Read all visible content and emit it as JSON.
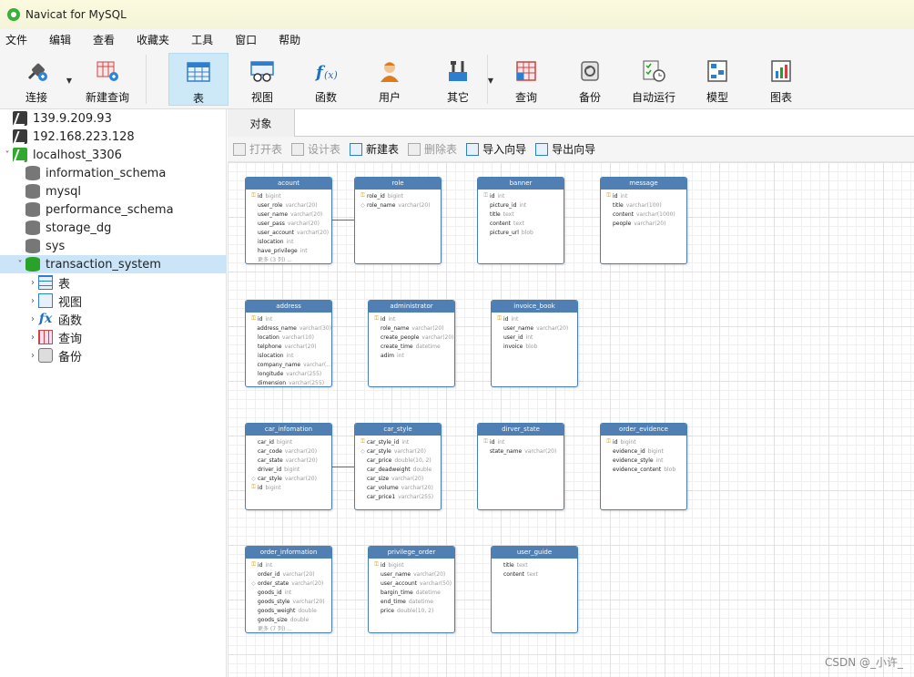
{
  "app": {
    "title": "Navicat for MySQL"
  },
  "menu": [
    "文件",
    "编辑",
    "查看",
    "收藏夹",
    "工具",
    "窗口",
    "帮助"
  ],
  "toolbar": [
    {
      "id": "connect",
      "label": "连接",
      "icon": "plug-icon"
    },
    {
      "id": "new-query",
      "label": "新建查询",
      "icon": "new-query-icon"
    },
    {
      "id": "table",
      "label": "表",
      "icon": "table-icon",
      "active": true
    },
    {
      "id": "view",
      "label": "视图",
      "icon": "view-icon"
    },
    {
      "id": "function",
      "label": "函数",
      "icon": "function-icon"
    },
    {
      "id": "user",
      "label": "用户",
      "icon": "user-icon"
    },
    {
      "id": "other",
      "label": "其它",
      "icon": "tools-icon"
    },
    {
      "id": "query",
      "label": "查询",
      "icon": "query-icon"
    },
    {
      "id": "backup",
      "label": "备份",
      "icon": "backup-icon"
    },
    {
      "id": "auto-run",
      "label": "自动运行",
      "icon": "schedule-icon"
    },
    {
      "id": "model",
      "label": "模型",
      "icon": "model-icon"
    },
    {
      "id": "chart",
      "label": "图表",
      "icon": "chart-icon"
    }
  ],
  "tree": [
    {
      "label": "139.9.209.93",
      "icon": "server-icon",
      "level": 0
    },
    {
      "label": "192.168.223.128",
      "icon": "server-icon",
      "level": 0
    },
    {
      "label": "localhost_3306",
      "icon": "server-connected-icon",
      "level": 0,
      "expanded": true
    },
    {
      "label": "information_schema",
      "icon": "database-icon",
      "level": 1
    },
    {
      "label": "mysql",
      "icon": "database-icon",
      "level": 1
    },
    {
      "label": "performance_schema",
      "icon": "database-icon",
      "level": 1
    },
    {
      "label": "storage_dg",
      "icon": "database-icon",
      "level": 1
    },
    {
      "label": "sys",
      "icon": "database-icon",
      "level": 1
    },
    {
      "label": "transaction_system",
      "icon": "database-open-icon",
      "level": 1,
      "expanded": true,
      "selected": true
    },
    {
      "label": "表",
      "icon": "table-icon",
      "level": 2
    },
    {
      "label": "视图",
      "icon": "view-icon",
      "level": 2
    },
    {
      "label": "函数",
      "icon": "function-icon",
      "level": 2
    },
    {
      "label": "查询",
      "icon": "query-icon",
      "level": 2
    },
    {
      "label": "备份",
      "icon": "backup-icon",
      "level": 2
    }
  ],
  "tab": {
    "label": "对象"
  },
  "object_toolbar": [
    {
      "label": "打开表",
      "enabled": false
    },
    {
      "label": "设计表",
      "enabled": false
    },
    {
      "label": "新建表",
      "enabled": true
    },
    {
      "label": "删除表",
      "enabled": false
    },
    {
      "label": "导入向导",
      "enabled": true
    },
    {
      "label": "导出向导",
      "enabled": true
    }
  ],
  "entities": [
    {
      "name": "acount",
      "fields": [
        [
          "key",
          "id",
          "bigint"
        ],
        [
          "",
          "user_role",
          "varchar(20)"
        ],
        [
          "",
          "user_name",
          "varchar(20)"
        ],
        [
          "",
          "user_pass",
          "varchar(20)"
        ],
        [
          "",
          "user_account",
          "varchar(20)"
        ],
        [
          "",
          "islocation",
          "int"
        ],
        [
          "",
          "have_privilege",
          "int"
        ]
      ],
      "more": "更多 (3 列) ..."
    },
    {
      "name": "role",
      "fields": [
        [
          "key",
          "role_id",
          "bigint"
        ],
        [
          "dot",
          "role_name",
          "varchar(20)"
        ]
      ]
    },
    {
      "name": "banner",
      "fields": [
        [
          "key",
          "id",
          "int"
        ],
        [
          "",
          "picture_id",
          "int"
        ],
        [
          "",
          "title",
          "text"
        ],
        [
          "",
          "content",
          "text"
        ],
        [
          "",
          "picture_url",
          "blob"
        ]
      ]
    },
    {
      "name": "message",
      "fields": [
        [
          "key",
          "id",
          "int"
        ],
        [
          "",
          "title",
          "varchar(100)"
        ],
        [
          "",
          "content",
          "varchar(1000)"
        ],
        [
          "",
          "people",
          "varchar(20)"
        ]
      ]
    },
    {
      "name": "address",
      "fields": [
        [
          "key",
          "id",
          "int"
        ],
        [
          "",
          "address_name",
          "varchar(30)"
        ],
        [
          "",
          "location",
          "varchar(10)"
        ],
        [
          "",
          "telphone",
          "varchar(20)"
        ],
        [
          "",
          "islocation",
          "int"
        ],
        [
          "",
          "company_name",
          "varchar(..."
        ],
        [
          "",
          "longitude",
          "varchar(255)"
        ],
        [
          "",
          "dimension",
          "varchar(255)"
        ]
      ]
    },
    {
      "name": "administrator",
      "fields": [
        [
          "key",
          "id",
          "int"
        ],
        [
          "",
          "role_name",
          "varchar(20)"
        ],
        [
          "",
          "create_people",
          "varchar(20)"
        ],
        [
          "",
          "create_time",
          "datetime"
        ],
        [
          "",
          "adim",
          "int"
        ]
      ]
    },
    {
      "name": "invoice_book",
      "fields": [
        [
          "key",
          "id",
          "int"
        ],
        [
          "",
          "user_name",
          "varchar(20)"
        ],
        [
          "",
          "user_id",
          "int"
        ],
        [
          "",
          "invoice",
          "blob"
        ]
      ]
    },
    {
      "name": "car_infomation",
      "fields": [
        [
          "",
          "car_id",
          "bigint"
        ],
        [
          "",
          "car_code",
          "varchar(20)"
        ],
        [
          "",
          "car_state",
          "varchar(20)"
        ],
        [
          "",
          "driver_id",
          "bigint"
        ],
        [
          "dot",
          "car_style",
          "varchar(20)"
        ],
        [
          "key",
          "id",
          "bigint"
        ]
      ]
    },
    {
      "name": "car_style",
      "fields": [
        [
          "key",
          "car_style_id",
          "int"
        ],
        [
          "dot",
          "car_style",
          "varchar(20)"
        ],
        [
          "",
          "car_price",
          "double(10, 2)"
        ],
        [
          "",
          "car_deadweight",
          "double"
        ],
        [
          "",
          "car_size",
          "varchar(20)"
        ],
        [
          "",
          "car_volume",
          "varchar(20)"
        ],
        [
          "",
          "car_price1",
          "varchar(255)"
        ]
      ]
    },
    {
      "name": "dirver_state",
      "fields": [
        [
          "key",
          "id",
          "int"
        ],
        [
          "",
          "state_name",
          "varchar(20)"
        ]
      ]
    },
    {
      "name": "order_evidence",
      "fields": [
        [
          "key",
          "id",
          "bigint"
        ],
        [
          "",
          "evidence_id",
          "bigint"
        ],
        [
          "",
          "evidence_style",
          "int"
        ],
        [
          "",
          "evidence_content",
          "blob"
        ]
      ]
    },
    {
      "name": "order_information",
      "fields": [
        [
          "key",
          "id",
          "int"
        ],
        [
          "",
          "order_id",
          "varchar(20)"
        ],
        [
          "dot",
          "order_state",
          "varchar(20)"
        ],
        [
          "",
          "goods_id",
          "int"
        ],
        [
          "",
          "goods_style",
          "varchar(20)"
        ],
        [
          "",
          "goods_weight",
          "double"
        ],
        [
          "",
          "goods_size",
          "double"
        ]
      ],
      "more": "更多 (7 列) ..."
    },
    {
      "name": "privilege_order",
      "fields": [
        [
          "key",
          "id",
          "bigint"
        ],
        [
          "",
          "user_name",
          "varchar(20)"
        ],
        [
          "",
          "user_account",
          "varchar(50)"
        ],
        [
          "",
          "bargin_time",
          "datetime"
        ],
        [
          "",
          "end_time",
          "datetime"
        ],
        [
          "",
          "price",
          "double(10, 2)"
        ]
      ]
    },
    {
      "name": "user_guide",
      "fields": [
        [
          "",
          "title",
          "text"
        ],
        [
          "",
          "content",
          "text"
        ]
      ]
    }
  ],
  "watermark": "CSDN @_小许_"
}
